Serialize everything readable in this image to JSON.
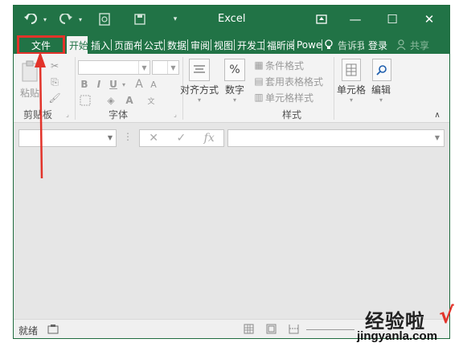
{
  "title_bar": {
    "app_title": "Excel",
    "undo_icon": "undo-icon",
    "redo_icon": "redo-icon",
    "minimize_glyph": "—",
    "maximize_glyph": "☐",
    "close_glyph": "✕"
  },
  "tabs": {
    "file": "文件",
    "items": [
      "开始",
      "插入",
      "页面布",
      "公式",
      "数据",
      "审阅",
      "视图",
      "开发工",
      "福昕阅",
      "Powe"
    ],
    "tell_me": "告诉我",
    "login": "登录",
    "share": "共享"
  },
  "ribbon": {
    "clipboard": {
      "paste": "粘贴",
      "label": "剪贴板"
    },
    "font": {
      "bold": "B",
      "italic": "I",
      "underline": "U",
      "grow": "A",
      "shrink": "A",
      "font_color": "A",
      "label": "字体"
    },
    "alignment": {
      "label": "对齐方式"
    },
    "number": {
      "symbol": "%",
      "label": "数字"
    },
    "styles": {
      "conditional": "条件格式",
      "table": "套用表格格式",
      "cell": "单元格样式",
      "label": "样式"
    },
    "cells": {
      "label": "单元格"
    },
    "editing": {
      "label": "编辑"
    }
  },
  "formula_bar": {
    "cancel": "✕",
    "enter": "✓",
    "fx": "fx",
    "value": ""
  },
  "status_bar": {
    "status": "就绪"
  },
  "watermark": {
    "brand": "经验啦",
    "check": "√",
    "url": "jingyanla.com"
  },
  "colors": {
    "excel_green": "#217346",
    "highlight_red": "#e2332a"
  }
}
